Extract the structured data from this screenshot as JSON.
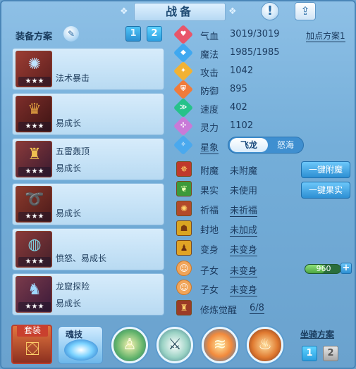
{
  "window": {
    "title": "战备"
  },
  "header": {
    "help_icon": "exclamation-icon",
    "share_icon": "share-icon"
  },
  "equipment_plan": {
    "label": "装备方案",
    "edit_icon": "pencil-icon",
    "plans": [
      "1",
      "2"
    ]
  },
  "equipment": [
    {
      "lines": [
        "法术暴击",
        ""
      ],
      "stars": "★★★",
      "icon": "fan-icon"
    },
    {
      "lines": [
        "易成长",
        ""
      ],
      "stars": "★★★",
      "icon": "armor-icon"
    },
    {
      "lines": [
        "五雷轰顶",
        "易成长"
      ],
      "stars": "★★★",
      "icon": "helmet-icon"
    },
    {
      "lines": [
        "易成长",
        ""
      ],
      "stars": "★★★",
      "icon": "necklace-icon"
    },
    {
      "lines": [
        "愤怒、易成长",
        ""
      ],
      "stars": "★★★",
      "icon": "belt-icon"
    },
    {
      "lines": [
        "龙窟探险",
        "易成长"
      ],
      "stars": "★★★",
      "icon": "boots-icon"
    }
  ],
  "stats": [
    {
      "label": "气血",
      "value": "3019/3019",
      "color": "#e8566a"
    },
    {
      "label": "魔法",
      "value": "1985/1985",
      "color": "#3fa8f0"
    },
    {
      "label": "攻击",
      "value": "1042",
      "color": "#f2b233"
    },
    {
      "label": "防御",
      "value": "895",
      "color": "#f07b3a"
    },
    {
      "label": "速度",
      "value": "402",
      "color": "#26c28a"
    },
    {
      "label": "灵力",
      "value": "1102",
      "color": "#c97ad8"
    }
  ],
  "add_point_plan": "加点方案1",
  "xingxiang": {
    "label": "星象",
    "options": [
      "飞龙",
      "怒海"
    ]
  },
  "progression": [
    {
      "label": "附魔",
      "value": "未附魔",
      "icon": "enchant-icon",
      "bg": "#c0392b"
    },
    {
      "label": "果实",
      "value": "未使用",
      "icon": "fruit-icon",
      "bg": "#3c9a3a"
    },
    {
      "label": "祈福",
      "value": "未祈福",
      "icon": "blessing-icon",
      "bg": "#b34a2a"
    },
    {
      "label": "封地",
      "value": "未加成",
      "icon": "fief-icon",
      "bg": "#d9a421"
    },
    {
      "label": "变身",
      "value": "未变身",
      "icon": "transform-icon",
      "bg": "#e0a325"
    },
    {
      "label": "子女",
      "value": "未变身",
      "icon": "child-icon",
      "bg": "#f1a55a"
    },
    {
      "label": "子女",
      "value": "未变身",
      "icon": "child-icon",
      "bg": "#f1a55a"
    },
    {
      "label": "修炼觉醒",
      "value": "6/8",
      "icon": "cultivation-icon",
      "bg": "#9b3b26"
    }
  ],
  "buttons": {
    "one_click_enchant": "一键附魔",
    "one_click_fruit": "一键果实"
  },
  "points": {
    "value": "960",
    "fill_fraction": 0.55
  },
  "bottom": {
    "suit_label": "套装",
    "soul_label": "魂技",
    "skills": [
      "warrior-icon",
      "sword-icon",
      "wave-icon",
      "fire-icon"
    ],
    "mount_label": "坐骑方案",
    "mount_plans": [
      "1",
      "2"
    ]
  }
}
